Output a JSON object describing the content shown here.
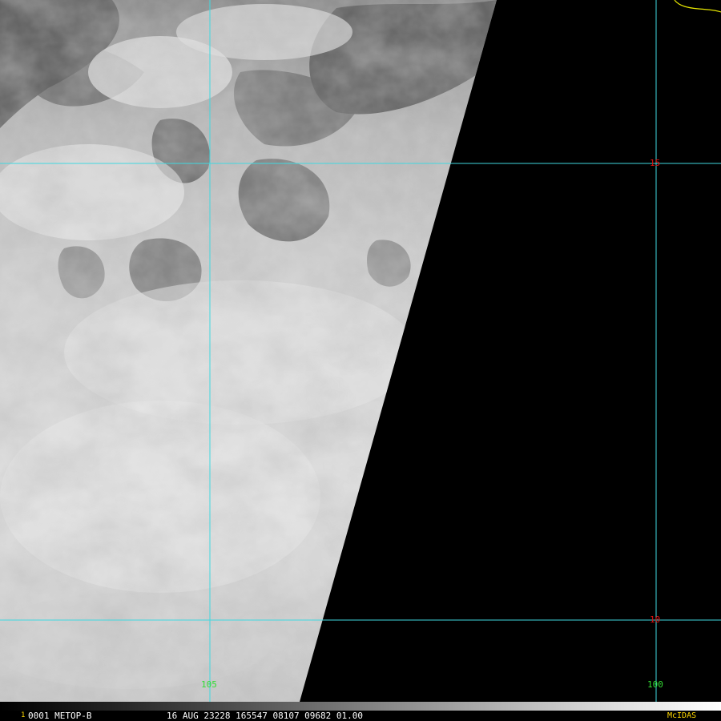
{
  "image": {
    "satellite": "METOP-B",
    "frame_number": "1",
    "frame_id": "0001 METOP-B",
    "timestamp_line": "16 AUG 23228 165547 08107 09682 01.00",
    "software": "McIDAS"
  },
  "grid": {
    "latitude_labels": [
      "15",
      "10"
    ],
    "longitude_labels": [
      "105",
      "100"
    ]
  },
  "colors": {
    "grid_lines": "#3fd8e0",
    "lat_label": "#e01010",
    "lon_label": "#33dd33",
    "coastline": "#e6e600",
    "frame_number": "#ffd700",
    "status_text": "#ffffff",
    "no_data": "#000000"
  }
}
